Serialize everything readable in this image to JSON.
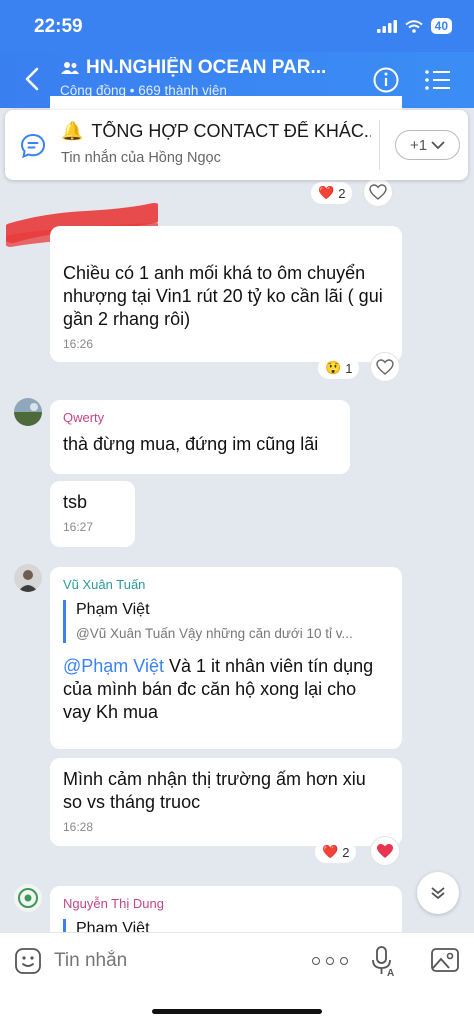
{
  "status": {
    "time": "22:59",
    "battery": "40"
  },
  "header": {
    "title": "HN.NGHIỆN OCEAN PAR...",
    "subtitle": "Cộng đồng • 669 thành viên"
  },
  "pinned": {
    "title": "TỔNG HỢP CONTACT ĐỂ KHÁC...",
    "subtitle": "Tin nhắn của Hồng Ngọc",
    "more_label": "+1"
  },
  "messages": [
    {
      "reactions": {
        "emoji": "❤️",
        "count": "2"
      }
    },
    {
      "text": "Chiều có 1 anh mối khá to ôm chuyển nhượng tại Vin1 rút 20 tỷ ko cần lãi ( gui gần 2 rhang rôi)",
      "time": "16:26",
      "reactions": {
        "emoji": "😲",
        "count": "1"
      }
    },
    {
      "sender": "Qwerty",
      "text": "thà đừng mua, đứng im cũng lãi"
    },
    {
      "text": "tsb",
      "time": "16:27"
    },
    {
      "sender": "Vũ Xuân Tuấn",
      "quote_name": "Phạm Việt",
      "quote_text": "@Vũ Xuân Tuấn Vậy những căn dưới 10 tỉ v...",
      "mention": "@Phạm Việt",
      "text": " Và 1 it nhân viên tín dụng của mình bán đc căn hộ xong lại cho vay Kh mua"
    },
    {
      "text": "Mình cảm nhận thị trường ấm hơn xiu so vs tháng truoc",
      "time": "16:28",
      "reactions": {
        "emoji": "❤️",
        "count": "2"
      }
    },
    {
      "sender": "Nguyễn Thị Dung",
      "quote_name": "Phạm Việt"
    }
  ],
  "input": {
    "placeholder": "Tin nhắn"
  },
  "colors": {
    "accent": "#3A82F2",
    "background": "#E3E8EF",
    "heart": "#E8344E"
  }
}
